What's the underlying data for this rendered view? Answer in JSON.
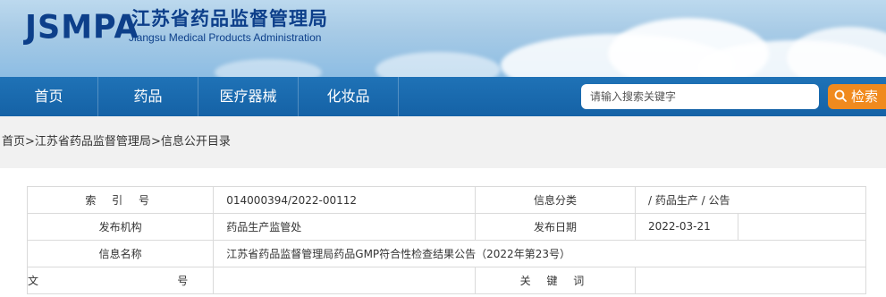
{
  "site": {
    "logo_text": "JSMPA",
    "title_cn": "江苏省药品监督管理局",
    "title_en": "Jiangsu Medical Products Administration",
    "top_links": "·········  ·········  ·········"
  },
  "nav": {
    "items": [
      {
        "label": "首页"
      },
      {
        "label": "药品"
      },
      {
        "label": "医疗器械"
      },
      {
        "label": "化妆品"
      }
    ]
  },
  "search": {
    "placeholder": "请输入搜索关键字",
    "button_label": "检索"
  },
  "breadcrumb": {
    "items": [
      "首页",
      "江苏省药品监督管理局",
      "信息公开目录"
    ],
    "separator": ">"
  },
  "info": {
    "rows": [
      {
        "label1": "索 引 号",
        "value1": "014000394/2022-00112",
        "label2": "信息分类",
        "value2": "/  药品生产  /  公告"
      },
      {
        "label1": "发布机构",
        "value1": "药品生产监管处",
        "label2": "发布日期",
        "value2": "2022-03-21"
      },
      {
        "label1": "信息名称",
        "value1": "江苏省药品监督管理局药品GMP符合性检查结果公告（2022年第23号）"
      },
      {
        "label1": "文    号",
        "value1": "",
        "label2": "关 键 词",
        "value2": ""
      }
    ]
  },
  "colors": {
    "nav_bg": "#1a6aae",
    "search_btn": "#f08a1e",
    "logo": "#0d3f8a",
    "crumb_bg": "#f1f1f1"
  }
}
